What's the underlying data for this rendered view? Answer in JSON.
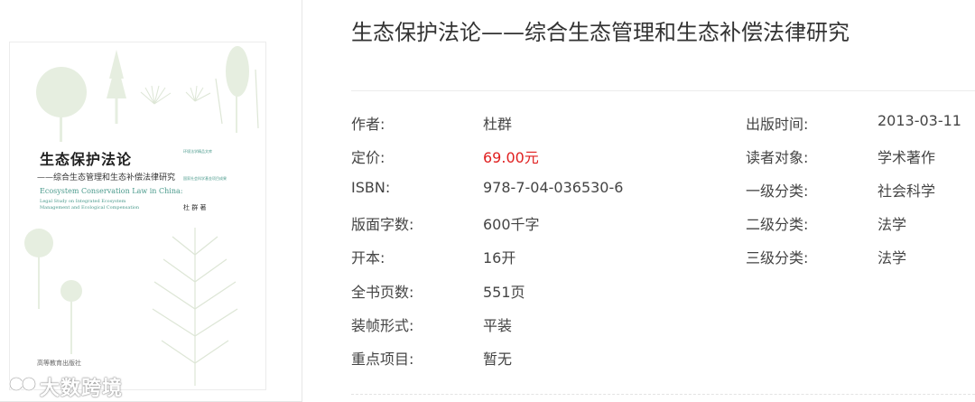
{
  "cover": {
    "title": "生态保护法论",
    "subtitle": "——综合生态管理和生态补偿法律研究",
    "en_title": "Ecosystem Conservation Law in China:",
    "en_line2": "Legal Study on Integrated Ecosystem",
    "en_line3": "Management and Ecological Compensation",
    "series_1": "环境法学精品文库",
    "series_2": "国家社会科学基金项目成果",
    "author": "杜 群 著",
    "publisher": "高等教育出版社"
  },
  "watermark": "大数跨境",
  "book": {
    "title": "生态保护法论——综合生态管理和生态补偿法律研究"
  },
  "details_left": [
    {
      "label": "作者:",
      "value": "杜群"
    },
    {
      "label": "定价:",
      "value": "69.00元"
    },
    {
      "label": "ISBN:",
      "value": "978-7-04-036530-6"
    },
    {
      "label": "版面字数:",
      "value": "600千字"
    },
    {
      "label": "开本:",
      "value": "16开"
    },
    {
      "label": "全书页数:",
      "value": "551页"
    },
    {
      "label": "装帧形式:",
      "value": "平装"
    },
    {
      "label": "重点项目:",
      "value": "暂无"
    }
  ],
  "details_right": [
    {
      "label": "出版时间:",
      "value": "2013-03-11"
    },
    {
      "label": "读者对象:",
      "value": "学术著作"
    },
    {
      "label": "一级分类:",
      "value": "社会科学"
    },
    {
      "label": "二级分类:",
      "value": "法学"
    },
    {
      "label": "三级分类:",
      "value": "法学"
    }
  ],
  "colors": {
    "price": "#e02020",
    "text": "#444444",
    "cover_accent": "#4a9a8c",
    "tree": "#e6eee0"
  }
}
